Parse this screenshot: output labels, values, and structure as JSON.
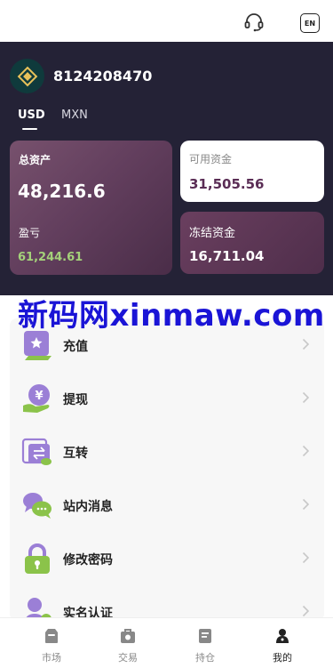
{
  "header": {
    "support_icon": "headset-icon",
    "lang_label": "EN"
  },
  "account": {
    "logo_icon": "diamond-logo-icon",
    "id": "8124208470"
  },
  "currency_tabs": [
    {
      "label": "USD",
      "active": true
    },
    {
      "label": "MXN",
      "active": false
    }
  ],
  "assets": {
    "total_label": "总资产",
    "total_value": "48,216.6",
    "pnl_label": "盈亏",
    "pnl_value": "61,244.61",
    "available_label": "可用资金",
    "available_value": "31,505.56",
    "frozen_label": "冻结资金",
    "frozen_value": "16,711.04"
  },
  "watermark": "新码网xinmaw.com",
  "menu": [
    {
      "label": "充值",
      "icon": "deposit-icon"
    },
    {
      "label": "提现",
      "icon": "withdraw-icon"
    },
    {
      "label": "互转",
      "icon": "transfer-icon"
    },
    {
      "label": "站内消息",
      "icon": "message-icon"
    },
    {
      "label": "修改密码",
      "icon": "lock-icon"
    },
    {
      "label": "实名认证",
      "icon": "user-verify-icon"
    }
  ],
  "bottom_nav": [
    {
      "label": "市场",
      "icon": "market-icon",
      "active": false
    },
    {
      "label": "交易",
      "icon": "trade-icon",
      "active": false
    },
    {
      "label": "持仓",
      "icon": "position-icon",
      "active": false
    },
    {
      "label": "我的",
      "icon": "profile-icon",
      "active": true
    }
  ],
  "colors": {
    "hero_bg": "#242236",
    "pnl_green": "#a4d17a",
    "accent_purple": "#5a2d55",
    "icon_purple": "#9b7fd6",
    "icon_green": "#8bc34a"
  }
}
